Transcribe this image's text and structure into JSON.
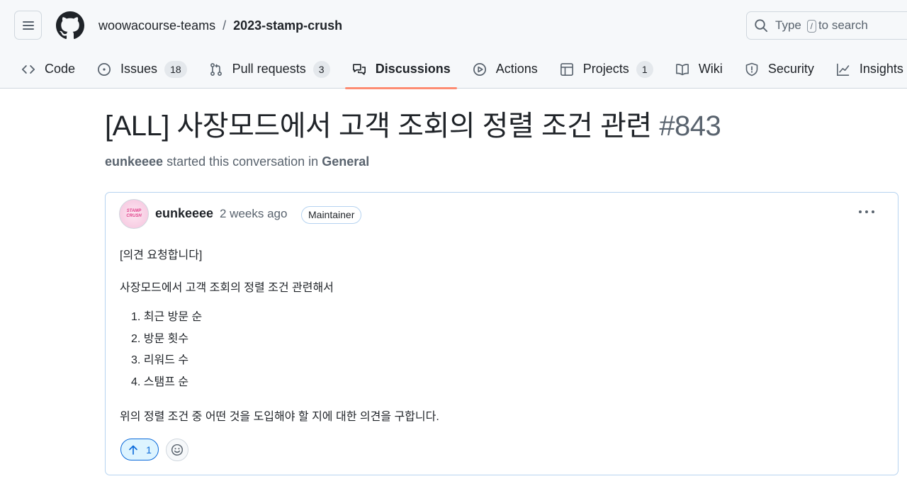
{
  "header": {
    "owner": "woowacourse-teams",
    "separator": "/",
    "repo": "2023-stamp-crush",
    "search_prefix": "Type",
    "search_key": "/",
    "search_suffix": "to search"
  },
  "tabs": [
    {
      "label": "Code",
      "icon": "code-icon"
    },
    {
      "label": "Issues",
      "count": "18",
      "icon": "issue-icon"
    },
    {
      "label": "Pull requests",
      "count": "3",
      "icon": "pull-request-icon"
    },
    {
      "label": "Discussions",
      "icon": "discussion-icon",
      "active": true
    },
    {
      "label": "Actions",
      "icon": "play-icon"
    },
    {
      "label": "Projects",
      "count": "1",
      "icon": "table-icon"
    },
    {
      "label": "Wiki",
      "icon": "book-icon"
    },
    {
      "label": "Security",
      "icon": "shield-icon"
    },
    {
      "label": "Insights",
      "icon": "graph-icon"
    }
  ],
  "discussion": {
    "title": "[ALL] 사장모드에서 고객 조회의 정렬 조건 관련",
    "number": "#843",
    "starter": "eunkeeee",
    "started_text": "started this conversation in",
    "category": "General"
  },
  "post": {
    "avatar_text": "STAMP CRUSH",
    "author": "eunkeeee",
    "time": "2 weeks ago",
    "role": "Maintainer",
    "p1": "[의견 요청합니다]",
    "p2": "사장모드에서 고객 조회의 정렬 조건 관련해서",
    "list": [
      "1. 최근 방문 순",
      "2. 방문 횟수",
      "3. 리워드 수",
      "4. 스탬프 순"
    ],
    "p3": "위의 정렬 조건 중 어떤 것을 도입해야 할 지에 대한 의견을 구합니다.",
    "upvotes": "1"
  },
  "colors": {
    "accent_underline": "#fd8c73",
    "link_blue": "#0969da",
    "card_border": "#b6d3f0"
  }
}
